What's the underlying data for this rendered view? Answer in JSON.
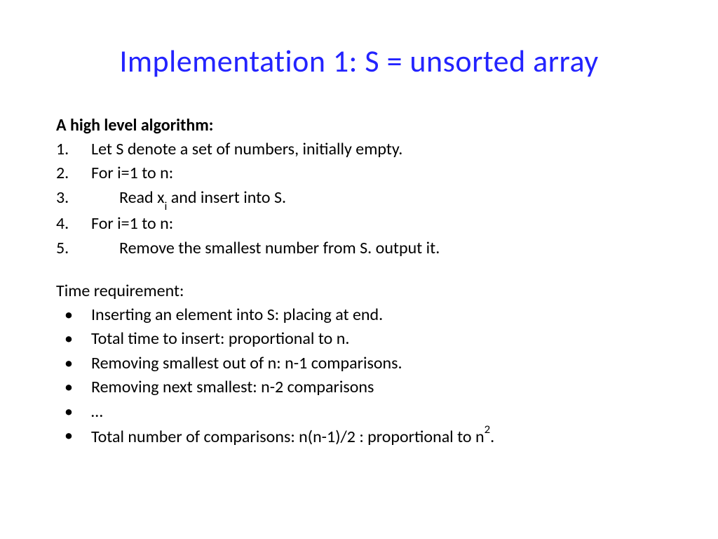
{
  "title": "Implementation 1: S = unsorted array",
  "subheading": "A high level algorithm:",
  "steps": [
    {
      "num": "1.",
      "text": "Let S denote a set of numbers, initially empty.",
      "indent": false
    },
    {
      "num": "2.",
      "text": "For i=1 to n:",
      "indent": false
    },
    {
      "num": "3.",
      "text": "Read x",
      "sub": "i",
      "text_after": " and insert into S.",
      "indent": true
    },
    {
      "num": "4.",
      "text": "For i=1 to n:",
      "indent": false
    },
    {
      "num": "5.",
      "text": "Remove the smallest number from S. output it.",
      "indent": true
    }
  ],
  "section_label": "Time requirement:",
  "bullets": [
    {
      "text": "Inserting an element into S: placing at end."
    },
    {
      "text": "Total time to insert: proportional to n."
    },
    {
      "text": "Removing smallest out of n: n-1 comparisons."
    },
    {
      "text": "Removing next smallest: n-2 comparisons"
    },
    {
      "text": "…"
    },
    {
      "text": "Total number of comparisons: n(n-1)/2 : proportional to n",
      "sup": "2",
      "text_after": "."
    }
  ],
  "bullet_char": "•"
}
